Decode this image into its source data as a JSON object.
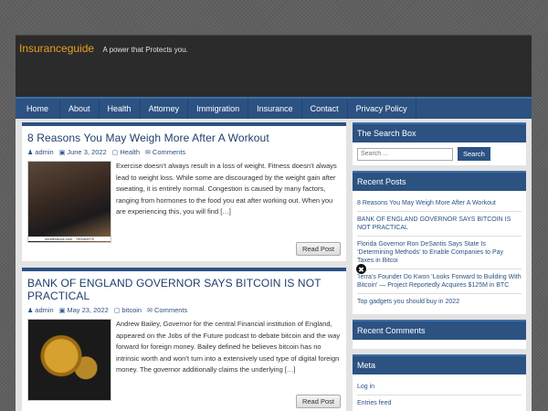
{
  "site": {
    "title": "Insuranceguide",
    "description": "A power that Protects you."
  },
  "nav": [
    "Home",
    "About",
    "Health",
    "Attorney",
    "Immigration",
    "Insurance",
    "Contact",
    "Privacy Policy"
  ],
  "posts": [
    {
      "title": "8 Reasons You May Weigh More After A Workout",
      "author": "admin",
      "date": "June 3, 2022",
      "category": "Health",
      "comments": "Comments",
      "thumb_caption": "shutterstock.com · 789364975",
      "excerpt": "Exercise doesn’t always result in a loss of weight. Fitness doesn’t always lead to weight loss. While some are discouraged by the weight gain after sweating, it is entirely normal. Congestion is caused by many factors, ranging from hormones to the food you eat after working out. When you are experiencing this, you will find […]",
      "read_more": "Read Post"
    },
    {
      "title": "BANK OF ENGLAND GOVERNOR SAYS BITCOIN IS NOT PRACTICAL",
      "author": "admin",
      "date": "May 23, 2022",
      "category": "bitcoin",
      "comments": "Comments",
      "thumb_caption": "",
      "excerpt": "Andrew Bailey, Governor for the central Financial institution of England, appeared on the Jobs of the Future podcast to debate bitcoin and the way forward for foreign money. Bailey defined he believes bitcoin has no intrinsic worth and won’t turn into a extensively used type of digital foreign money. The governor additionally claims the underlying […]",
      "read_more": "Read Post"
    }
  ],
  "sidebar": {
    "search": {
      "title": "The Search Box",
      "placeholder": "Search ...",
      "button": "Search"
    },
    "recent_posts": {
      "title": "Recent Posts",
      "items": [
        "8 Reasons You May Weigh More After A Workout",
        "BANK OF ENGLAND GOVERNOR SAYS BITCOIN IS NOT PRACTICAL",
        "Florida Governor Ron DeSantis Says State Is ‘Determining Methods’ to Enable Companies to Pay Taxes in Bitcoi",
        "Terra’s Founder Do Kwon ‘Looks Forward to Building With Bitcoin’ — Project Reportedly Acquires $125M in BTC",
        "Top gadgets you should buy in 2022"
      ]
    },
    "recent_comments": {
      "title": "Recent Comments"
    },
    "meta": {
      "title": "Meta",
      "items": [
        "Log in",
        "Entries feed"
      ]
    }
  },
  "colors": {
    "accent": "#2c5282",
    "title_orange": "#e8a21a",
    "header_bg": "#2b2b2b"
  }
}
